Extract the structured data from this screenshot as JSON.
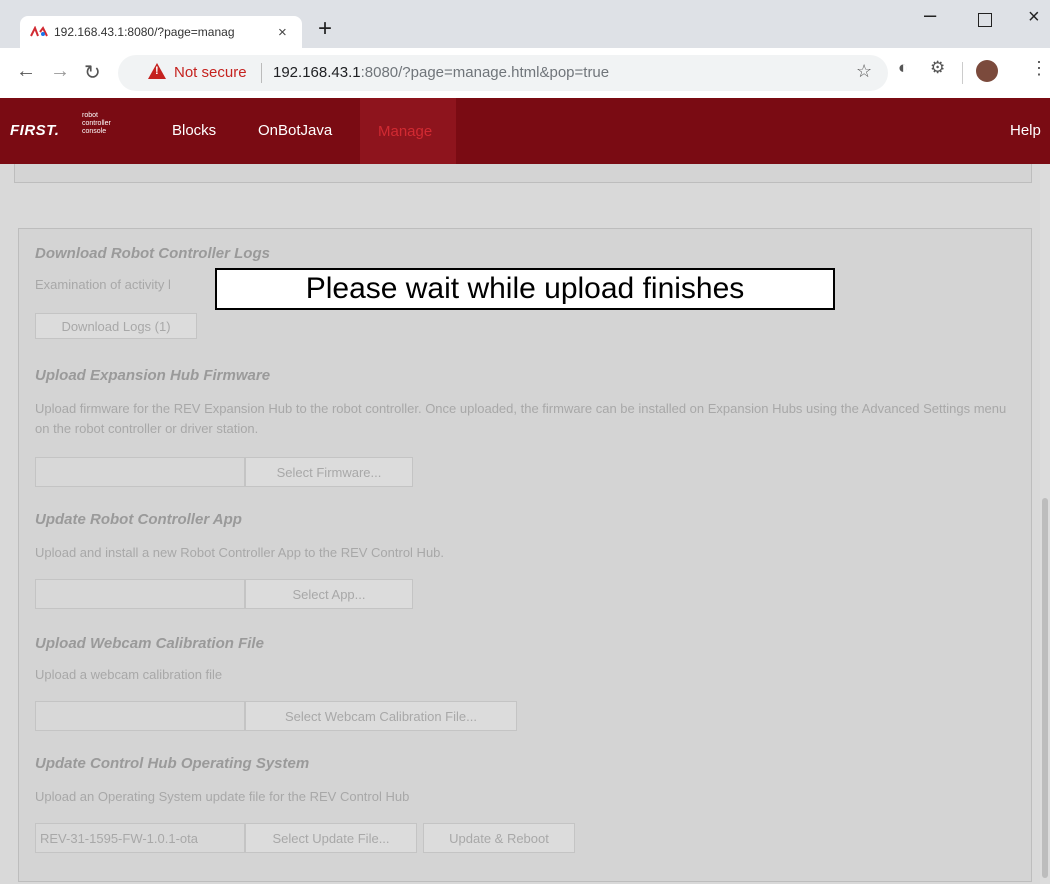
{
  "browser": {
    "tab_title": "192.168.43.1:8080/?page=manag",
    "tab_close": "×",
    "new_tab": "+",
    "not_secure": "Not secure",
    "url_host": "192.168.43.1",
    "url_rest": ":8080/?page=manage.html&pop=true",
    "window_min": "–",
    "window_close": "×"
  },
  "appbar": {
    "logo": "FIRST.",
    "logo_sub": [
      "robot",
      "controller",
      "console"
    ],
    "nav": [
      "Blocks",
      "OnBotJava",
      "Manage"
    ],
    "help": "Help"
  },
  "sections": {
    "logs": {
      "title": "Download Robot Controller Logs",
      "text": "Examination of activity l",
      "button": "Download Logs (1)"
    },
    "firmware": {
      "title": "Upload Expansion Hub Firmware",
      "text": "Upload firmware for the REV Expansion Hub to the robot controller. Once uploaded, the firmware can be installed on Expansion Hubs using the Advanced Settings menu on the robot controller or driver station.",
      "field": "",
      "button": "Select Firmware..."
    },
    "app": {
      "title": "Update Robot Controller App",
      "text": "Upload and install a new Robot Controller App to the REV Control Hub.",
      "field": "",
      "button": "Select App..."
    },
    "webcam": {
      "title": "Upload Webcam Calibration File",
      "text": "Upload a webcam calibration file",
      "field": "",
      "button": "Select Webcam Calibration File..."
    },
    "os": {
      "title": "Update Control Hub Operating System",
      "text": "Upload an Operating System update file for the REV Control Hub",
      "field": "REV-31-1595-FW-1.0.1-ota",
      "button": "Select Update File...",
      "button2": "Update & Reboot"
    }
  },
  "overlay": {
    "message": "Please wait while upload finishes"
  }
}
